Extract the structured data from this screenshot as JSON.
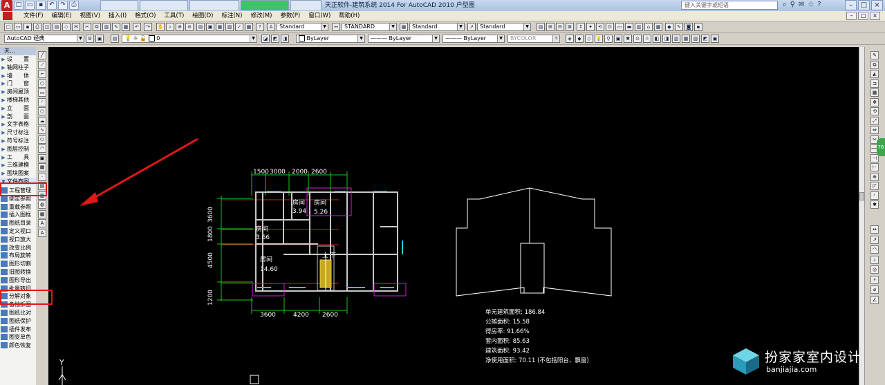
{
  "titlebar": {
    "app_logo": "A",
    "tabs": [
      "",
      "",
      "",
      "",
      ""
    ],
    "title": "天正软件-建筑系统 2014  For AutoCAD 2010        户型图",
    "search_placeholder": "键入关键字或短语",
    "window_buttons": [
      "–",
      "□",
      "×"
    ]
  },
  "menu": {
    "items": [
      "文件(F)",
      "编辑(E)",
      "视图(V)",
      "插入(I)",
      "格式(O)",
      "工具(T)",
      "绘图(D)",
      "标注(N)",
      "修改(M)",
      "参数(P)",
      "窗口(W)",
      "帮助(H)"
    ],
    "doc_buttons": [
      "–",
      "□",
      "×"
    ]
  },
  "toolbar2": {
    "text_style": "Standard",
    "dim_style": "STANDARD",
    "table_style": "Standard",
    "multileader_style": "Standard"
  },
  "toolbar3": {
    "workspace": "AutoCAD 经典",
    "layer_value": "0",
    "color": "ByLayer",
    "linetype": "ByLayer",
    "lineweight": "ByLayer",
    "plotstyle": "BYCOLOR"
  },
  "palette": {
    "header": "天...",
    "items": [
      {
        "label": "设　　置",
        "type": "group"
      },
      {
        "label": "轴网柱子",
        "type": "group"
      },
      {
        "label": "墙　　体",
        "type": "group"
      },
      {
        "label": "门　　窗",
        "type": "group"
      },
      {
        "label": "房间屋顶",
        "type": "group"
      },
      {
        "label": "楼梯其他",
        "type": "group"
      },
      {
        "label": "立　　面",
        "type": "group"
      },
      {
        "label": "剖　　面",
        "type": "group"
      },
      {
        "label": "文字表格",
        "type": "group"
      },
      {
        "label": "尺寸标注",
        "type": "group"
      },
      {
        "label": "符号标注",
        "type": "group"
      },
      {
        "label": "图层控制",
        "type": "group"
      },
      {
        "label": "工　　具",
        "type": "group"
      },
      {
        "label": "三维建模",
        "type": "group"
      },
      {
        "label": "图块图案",
        "type": "group"
      },
      {
        "label": "文件布图",
        "type": "open"
      },
      {
        "label": "工程管理",
        "type": "cmd"
      },
      {
        "label": "绑定参照",
        "type": "cmd"
      },
      {
        "label": "重载参照",
        "type": "cmd"
      },
      {
        "label": "插入图框",
        "type": "cmd"
      },
      {
        "label": "图纸目录",
        "type": "cmd"
      },
      {
        "label": "定义视口",
        "type": "cmd"
      },
      {
        "label": "视口放大",
        "type": "cmd"
      },
      {
        "label": "改变比例",
        "type": "cmd"
      },
      {
        "label": "布局旋转",
        "type": "cmd"
      },
      {
        "label": "图形切割",
        "type": "cmd"
      },
      {
        "label": "旧图转换",
        "type": "cmd"
      },
      {
        "label": "图形导出",
        "type": "cmd"
      },
      {
        "label": "批量转旧",
        "type": "cmd"
      },
      {
        "label": "分解对象",
        "type": "cmd"
      },
      {
        "label": "备档拆图",
        "type": "cmd"
      },
      {
        "label": "图纸比对",
        "type": "cmd"
      },
      {
        "label": "图纸保护",
        "type": "cmd"
      },
      {
        "label": "插件发布",
        "type": "cmd"
      },
      {
        "label": "图变单色",
        "type": "cmd"
      },
      {
        "label": "颜色恢复",
        "type": "cmd"
      }
    ]
  },
  "drawing": {
    "top_dims": [
      "1500",
      "3000",
      "2000",
      "2600"
    ],
    "bottom_dims": [
      "3600",
      "4200",
      "2600"
    ],
    "left_dims": [
      "3600",
      "1800",
      "4500",
      "1200"
    ],
    "rooms": [
      {
        "name": "房间",
        "area": "3.94"
      },
      {
        "name": "房间",
        "area": "5.26"
      },
      {
        "name": "房间",
        "area": "3.66"
      },
      {
        "name": "房间",
        "area": "14.60"
      }
    ],
    "stair_up": "上",
    "stair_down": "下",
    "stats": [
      "单元建筑面积: 186.84",
      "公摊面积: 15.58",
      "得房率: 91.66%",
      "套内面积: 85.63",
      "建筑面积: 93.42",
      "净使用面积: 70.11 (不包括阳台、飘窗)"
    ],
    "ucs_y": "Y"
  },
  "right_tab": "76",
  "watermark": {
    "cn": "扮家家室内设计",
    "en": "banjiajia.com"
  },
  "colors": {
    "canvas_bg": "#000000",
    "highlight": "#e01818",
    "arrow": "#e01818",
    "dim_green": "#18c818",
    "axis_red": "#e02020",
    "window_cyan": "#22d0d0",
    "door_magenta": "#d020d0"
  }
}
